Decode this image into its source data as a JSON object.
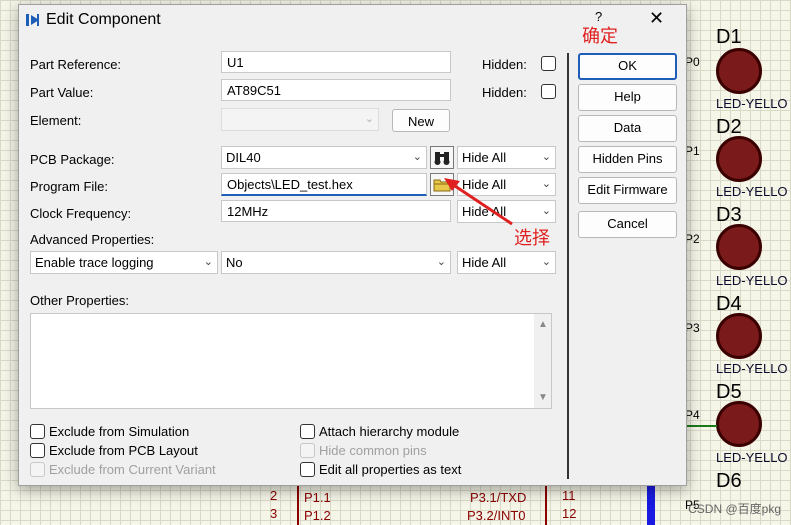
{
  "dialog": {
    "title": "Edit Component",
    "help": "?",
    "close": "✕"
  },
  "fields": {
    "part_reference": {
      "label": "Part Reference:",
      "value": "U1",
      "hidden_label": "Hidden:"
    },
    "part_value": {
      "label": "Part Value:",
      "value": "AT89C51",
      "hidden_label": "Hidden:"
    },
    "element": {
      "label": "Element:",
      "value": "",
      "new_button": "New"
    },
    "pcb_package": {
      "label": "PCB Package:",
      "value": "DIL40",
      "visibility": "Hide All"
    },
    "program_file": {
      "label": "Program File:",
      "value": "Objects\\LED_test.hex",
      "visibility": "Hide All"
    },
    "clock_frequency": {
      "label": "Clock Frequency:",
      "value": "12MHz",
      "visibility": "Hide All"
    },
    "advanced_properties": {
      "label": "Advanced Properties:",
      "property": "Enable trace logging",
      "value": "No",
      "visibility": "Hide All"
    },
    "other_properties": {
      "label": "Other Properties:"
    }
  },
  "checkboxes": [
    {
      "label": "Exclude from Simulation",
      "checked": false,
      "enabled": true
    },
    {
      "label": "Exclude from PCB Layout",
      "checked": false,
      "enabled": true
    },
    {
      "label": "Exclude from Current Variant",
      "checked": false,
      "enabled": false
    },
    {
      "label": "Attach hierarchy module",
      "checked": false,
      "enabled": true
    },
    {
      "label": "Hide common pins",
      "checked": false,
      "enabled": false
    },
    {
      "label": "Edit all properties as text",
      "checked": false,
      "enabled": true
    }
  ],
  "buttons": {
    "ok": "OK",
    "help": "Help",
    "data": "Data",
    "hidden_pins": "Hidden Pins",
    "edit_firmware": "Edit Firmware",
    "cancel": "Cancel"
  },
  "annotations": {
    "confirm": "确定",
    "select": "选择",
    "color": "#e02020"
  },
  "schematic": {
    "leds": [
      {
        "ref": "D1",
        "name": "LED-YELLO",
        "pin": "P0"
      },
      {
        "ref": "D2",
        "name": "LED-YELLO",
        "pin": "P1"
      },
      {
        "ref": "D3",
        "name": "LED-YELLO",
        "pin": "P2"
      },
      {
        "ref": "D4",
        "name": "LED-YELLO",
        "pin": "P3"
      },
      {
        "ref": "D5",
        "name": "LED-YELLO",
        "pin": "P4"
      },
      {
        "ref": "D6",
        "name": "",
        "pin": "P5"
      }
    ],
    "chip_pins": [
      {
        "num": "2",
        "name": "P1.1",
        "right_name": "P3.1/TXD",
        "right_num": "11"
      },
      {
        "num": "3",
        "name": "P1.2",
        "right_name": "P3.2/INT0",
        "right_num": "12"
      }
    ],
    "watermark": "CSDN @百度pkg"
  }
}
